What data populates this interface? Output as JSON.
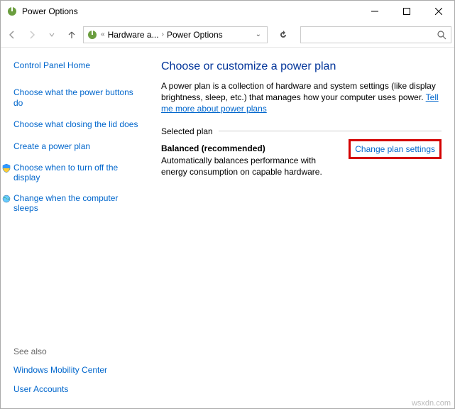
{
  "window": {
    "title": "Power Options"
  },
  "breadcrumb": {
    "item1": "Hardware a...",
    "item2": "Power Options"
  },
  "sidebar": {
    "home": "Control Panel Home",
    "links": [
      "Choose what the power buttons do",
      "Choose what closing the lid does",
      "Create a power plan",
      "Choose when to turn off the display",
      "Change when the computer sleeps"
    ],
    "see_also_label": "See also",
    "see_also": [
      "Windows Mobility Center",
      "User Accounts"
    ]
  },
  "content": {
    "heading": "Choose or customize a power plan",
    "desc": "A power plan is a collection of hardware and system settings (like display brightness, sleep, etc.) that manages how your computer uses power. ",
    "learn_more": "Tell me more about power plans",
    "section_label": "Selected plan",
    "plan_name": "Balanced (recommended)",
    "plan_desc": "Automatically balances performance with energy consumption on capable hardware.",
    "change_link": "Change plan settings"
  },
  "watermark": "wsxdn.com"
}
